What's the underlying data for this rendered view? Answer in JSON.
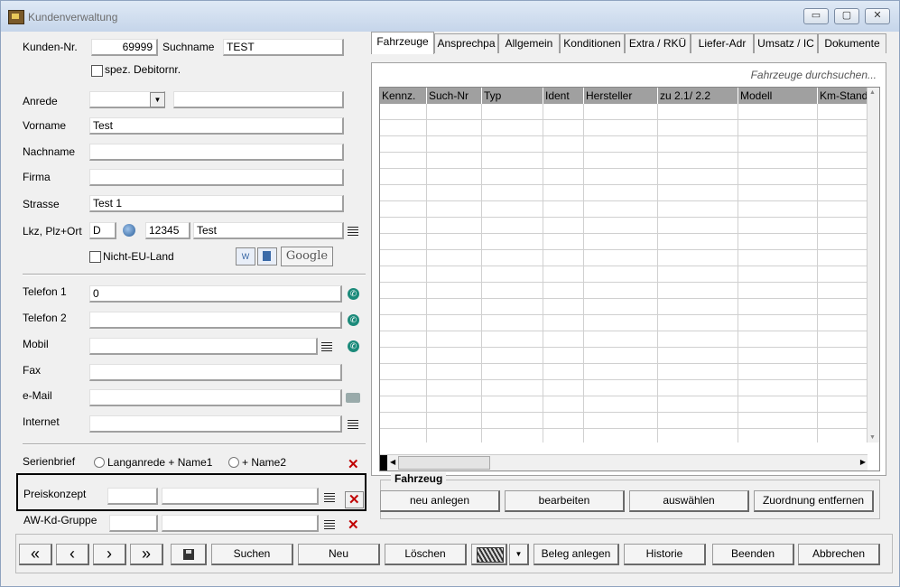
{
  "window": {
    "title": "Kundenverwaltung",
    "controls": {
      "minimize": "▭",
      "maximize": "▢",
      "close": "✕"
    }
  },
  "customer": {
    "nr_label": "Kunden-Nr.",
    "nr_value": "69999",
    "suchname_label": "Suchname",
    "suchname_value": "TEST",
    "spez_debitor_label": "spez. Debitornr.",
    "anrede_label": "Anrede",
    "anrede_value": "",
    "anrede_extra": "",
    "vorname_label": "Vorname",
    "vorname_value": "Test",
    "nachname_label": "Nachname",
    "nachname_value": "",
    "firma_label": "Firma",
    "firma_value": "",
    "strasse_label": "Strasse",
    "strasse_value": "Test 1",
    "lkz_label": "Lkz, Plz+Ort",
    "lkz_value": "D",
    "plz_value": "12345",
    "ort_value": "Test",
    "nicht_eu_label": "Nicht-EU-Land",
    "google_label": "Google"
  },
  "contact": {
    "telefon1_label": "Telefon 1",
    "telefon1_value": "0",
    "telefon2_label": "Telefon 2",
    "telefon2_value": "",
    "mobil_label": "Mobil",
    "mobil_value": "",
    "fax_label": "Fax",
    "fax_value": "",
    "email_label": "e-Mail",
    "email_value": "",
    "internet_label": "Internet",
    "internet_value": ""
  },
  "extras": {
    "serienbrief_label": "Serienbrief",
    "radio1_label": "Langanrede + Name1",
    "radio2_label": "+ Name2",
    "preiskonzept_label": "Preiskonzept",
    "preiskonzept_code": "",
    "preiskonzept_name": "",
    "awkd_label": "AW-Kd-Gruppe",
    "awkd_code": "",
    "awkd_name": ""
  },
  "tabs": [
    "Fahrzeuge",
    "Ansprechpa",
    "Allgemein",
    "Konditionen",
    "Extra / RKÜ",
    "Liefer-Adr",
    "Umsatz / IC",
    "Dokumente"
  ],
  "vehicles": {
    "search_placeholder": "Fahrzeuge durchsuchen...",
    "columns": [
      "Kennz.",
      "Such-Nr",
      "Typ",
      "Ident",
      "Hersteller",
      "zu 2.1/ 2.2",
      "Modell",
      "Km-Stand"
    ],
    "rows": []
  },
  "fahrzeug_group": {
    "label": "Fahrzeug",
    "buttons": [
      "neu anlegen",
      "bearbeiten",
      "auswählen",
      "Zuordnung entfernen"
    ]
  },
  "toolbar": {
    "first": "«",
    "prev": "‹",
    "next": "›",
    "last": "»",
    "suchen": "Suchen",
    "neu": "Neu",
    "loeschen": "Löschen",
    "beleg": "Beleg anlegen",
    "historie": "Historie",
    "beenden": "Beenden",
    "abbrechen": "Abbrechen"
  }
}
